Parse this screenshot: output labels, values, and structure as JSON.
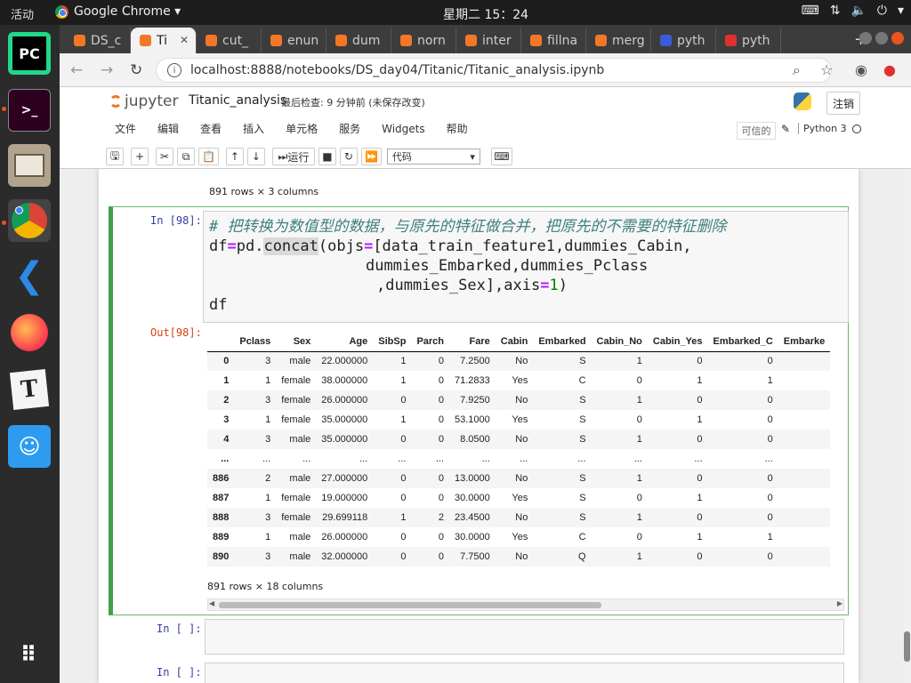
{
  "system_bar": {
    "activities": "活动",
    "app_name": "Google Chrome ▾",
    "clock": "星期二 15：24"
  },
  "dock": {
    "items": [
      "pycharm",
      "terminal",
      "files",
      "chrome",
      "vscode",
      "firefox",
      "typora",
      "qq"
    ]
  },
  "browser": {
    "tabs": [
      {
        "label": "DS_c",
        "color": "#f37726"
      },
      {
        "label": "Ti",
        "color": "#f37726",
        "active": true
      },
      {
        "label": "cut_",
        "color": "#f37726"
      },
      {
        "label": "enun",
        "color": "#f37726"
      },
      {
        "label": "dum",
        "color": "#f37726"
      },
      {
        "label": "norn",
        "color": "#f37726"
      },
      {
        "label": "inter",
        "color": "#f37726"
      },
      {
        "label": "fillna",
        "color": "#f37726"
      },
      {
        "label": "merg",
        "color": "#f37726"
      },
      {
        "label": "pyth",
        "color": "#3b5bdb"
      },
      {
        "label": "pyth",
        "color": "#e03131"
      }
    ],
    "url": "localhost:8888/notebooks/DS_day04/Titanic/Titanic_analysis.ipynb"
  },
  "jupyter": {
    "logo": "jupyter",
    "notebook_name": "Titanic_analysis",
    "checkpoint": "最后检查: 9 分钟前  (未保存改变)",
    "logout": "注销",
    "menu": [
      "文件",
      "编辑",
      "查看",
      "插入",
      "单元格",
      "服务",
      "Widgets",
      "帮助"
    ],
    "trusted": "可信的",
    "kernel": "Python 3",
    "toolbar": {
      "run_label": "运行",
      "cell_type": "代码"
    }
  },
  "notebook": {
    "prev_output_info": "891 rows × 3 columns",
    "cell": {
      "in_prompt": "In [98]:",
      "out_prompt": "Out[98]:",
      "code": {
        "comment": "# 把转换为数值型的数据，与原先的特征做合并，把原先的不需要的特征删除",
        "l1_a": "df",
        "l1_op1": "=",
        "l1_b": "pd.",
        "l1_hl": "concat",
        "l1_c": "(objs",
        "l1_op2": "=",
        "l1_d": "[data_train_feature1,dummies_Cabin,",
        "l2": "dummies_Embarked,dummies_Pclass",
        "l3_a": ",dummies_Sex],axis",
        "l3_op": "=",
        "l3_num": "1",
        "l3_b": ")",
        "l4": "df"
      },
      "dataframe": {
        "columns": [
          "",
          "Pclass",
          "Sex",
          "Age",
          "SibSp",
          "Parch",
          "Fare",
          "Cabin",
          "Embarked",
          "Cabin_No",
          "Cabin_Yes",
          "Embarked_C",
          "Embarke"
        ],
        "rows": [
          [
            "0",
            "3",
            "male",
            "22.000000",
            "1",
            "0",
            "7.2500",
            "No",
            "S",
            "1",
            "0",
            "0",
            ""
          ],
          [
            "1",
            "1",
            "female",
            "38.000000",
            "1",
            "0",
            "71.2833",
            "Yes",
            "C",
            "0",
            "1",
            "1",
            ""
          ],
          [
            "2",
            "3",
            "female",
            "26.000000",
            "0",
            "0",
            "7.9250",
            "No",
            "S",
            "1",
            "0",
            "0",
            ""
          ],
          [
            "3",
            "1",
            "female",
            "35.000000",
            "1",
            "0",
            "53.1000",
            "Yes",
            "S",
            "0",
            "1",
            "0",
            ""
          ],
          [
            "4",
            "3",
            "male",
            "35.000000",
            "0",
            "0",
            "8.0500",
            "No",
            "S",
            "1",
            "0",
            "0",
            ""
          ],
          [
            "...",
            "...",
            "...",
            "...",
            "...",
            "...",
            "...",
            "...",
            "...",
            "...",
            "...",
            "...",
            ""
          ],
          [
            "886",
            "2",
            "male",
            "27.000000",
            "0",
            "0",
            "13.0000",
            "No",
            "S",
            "1",
            "0",
            "0",
            ""
          ],
          [
            "887",
            "1",
            "female",
            "19.000000",
            "0",
            "0",
            "30.0000",
            "Yes",
            "S",
            "0",
            "1",
            "0",
            ""
          ],
          [
            "888",
            "3",
            "female",
            "29.699118",
            "1",
            "2",
            "23.4500",
            "No",
            "S",
            "1",
            "0",
            "0",
            ""
          ],
          [
            "889",
            "1",
            "male",
            "26.000000",
            "0",
            "0",
            "30.0000",
            "Yes",
            "C",
            "0",
            "1",
            "1",
            ""
          ],
          [
            "890",
            "3",
            "male",
            "32.000000",
            "0",
            "0",
            "7.7500",
            "No",
            "Q",
            "1",
            "0",
            "0",
            ""
          ]
        ],
        "shape_info": "891 rows × 18 columns"
      }
    },
    "empty_prompt": "In [ ]:"
  }
}
